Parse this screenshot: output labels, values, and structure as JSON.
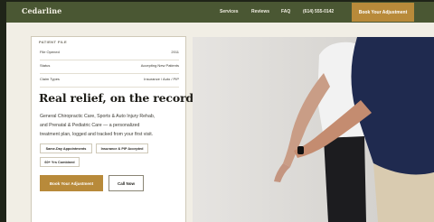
{
  "brand": {
    "name": "Cedarline"
  },
  "nav": {
    "links": [
      "Services",
      "Reviews",
      "FAQ",
      "(614) 555-0142"
    ],
    "cta": "Book Your Adjustment"
  },
  "patient_file": {
    "eyebrow": "PATIENT FILE",
    "rows": [
      {
        "label": "File Opened",
        "value": "2011"
      },
      {
        "label": "Status",
        "value": "Accepting New Patients"
      },
      {
        "label": "Claim Types",
        "value": "Insurance / Auto / PIP"
      }
    ]
  },
  "hero": {
    "headline": "Real relief, on the record.",
    "body_lines": [
      "General Chiropractic Care, Sports & Auto Injury Rehab,",
      "and Prenatal & Pediatric Care — a personalized",
      "treatment plan, logged and tracked from your first visit."
    ],
    "badges": [
      "Same-Day Appointments",
      "Insurance & PIP Accepted",
      "60+ Yrs Combined"
    ],
    "primary_cta": "Book Your Adjustment",
    "secondary_cta": "Call Now"
  },
  "colors": {
    "nav_bg": "#4a5733",
    "accent": "#b88a3a",
    "page_bg": "#f1eee5"
  },
  "image": {
    "alt": "Chiropractor stretching a patient's arm"
  }
}
